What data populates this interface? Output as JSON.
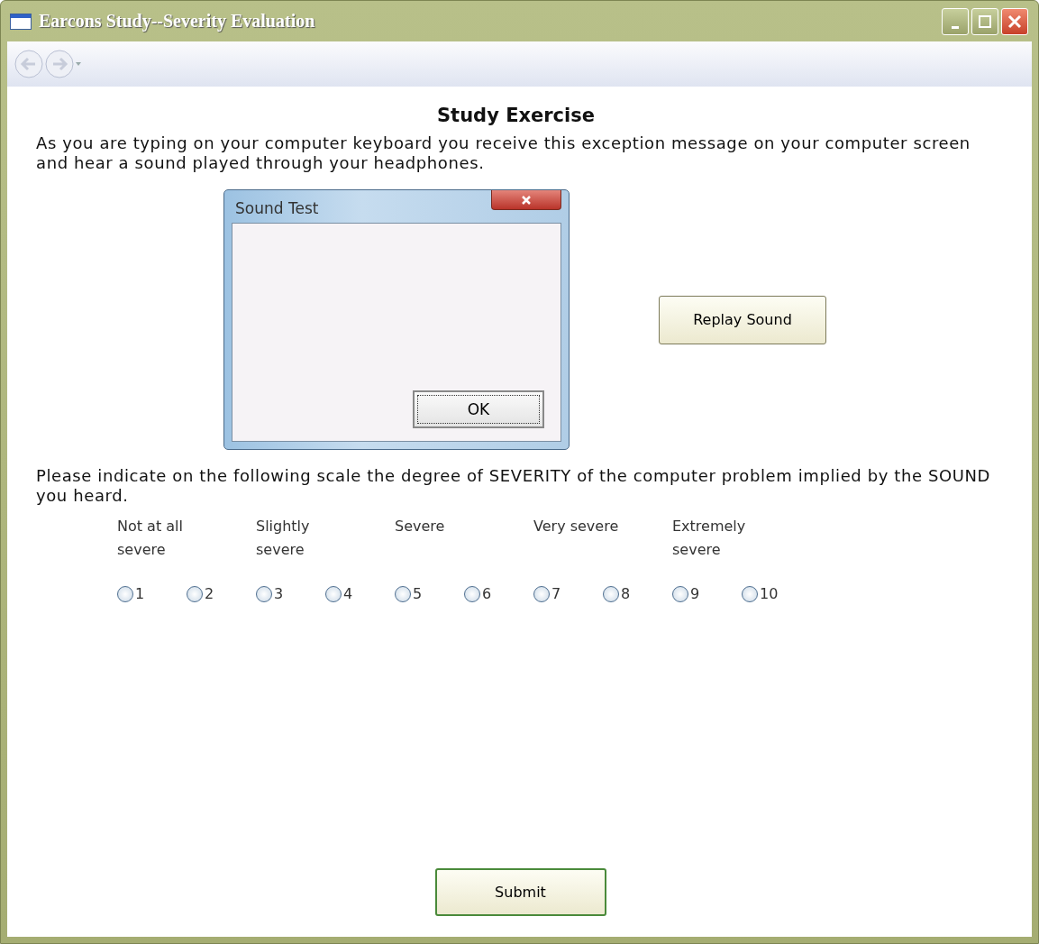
{
  "window": {
    "title": "Earcons Study--Severity Evaluation"
  },
  "heading": "Study Exercise",
  "intro": "As you are typing on your computer keyboard you receive this  exception message on your computer screen and hear a sound played through your headphones.",
  "dialog": {
    "title": "Sound Test",
    "button": "OK"
  },
  "replay_button": "Replay Sound",
  "question": "Please indicate on the following scale the degree of SEVERITY of the computer problem implied by the SOUND you heard.",
  "scale_labels": [
    "Not at all severe",
    "Slightly severe",
    "Severe",
    "Very severe",
    "Extremely severe"
  ],
  "options": [
    {
      "label": "1",
      "selected": false
    },
    {
      "label": "2",
      "selected": false
    },
    {
      "label": "3",
      "selected": false
    },
    {
      "label": "4",
      "selected": false
    },
    {
      "label": "5",
      "selected": false
    },
    {
      "label": "6",
      "selected": false
    },
    {
      "label": "7",
      "selected": false
    },
    {
      "label": "8",
      "selected": false
    },
    {
      "label": "9",
      "selected": false
    },
    {
      "label": "10",
      "selected": false
    }
  ],
  "submit_button": "Submit"
}
